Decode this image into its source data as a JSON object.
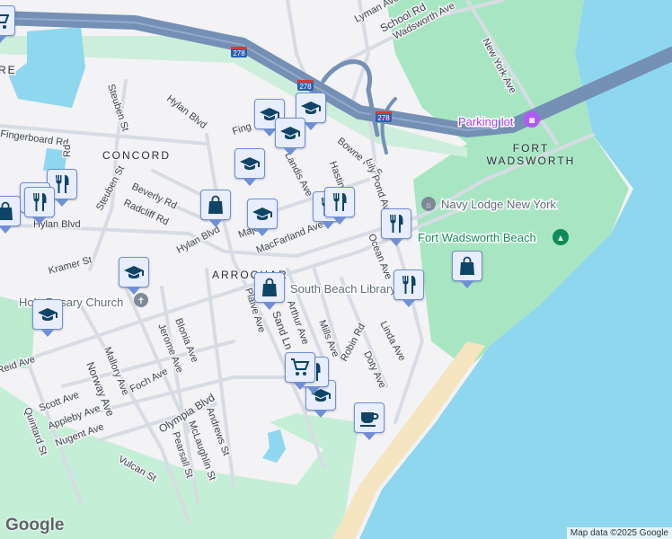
{
  "map": {
    "neighborhoods": [
      "CONCORD",
      "ARROCHAR",
      "FORT WADSWORTH"
    ],
    "neighborhood_partial_left": "RE",
    "streets": {
      "lyman": "Lyman Ave",
      "school": "School Rd",
      "wadsworth": "Wadsworth Ave",
      "new_york": "New York Ave",
      "steuben": "Steuben St",
      "hylan": "Hylan Blvd",
      "fingerboard": "Fingerboard Rd",
      "fing": "Fing",
      "landis": "Landis Ave",
      "hastings": "Hastings St",
      "bowne": "Bowne Rd S",
      "lily_pond": "Lily Pond Ave",
      "beverly": "Beverly Rd",
      "radcliff": "Radcliff Rd",
      "macfarland": "MacFarland Ave",
      "major": "Major",
      "kramer": "Kramer St",
      "ocean": "Ocean Ave",
      "plaive": "Plaive Ave",
      "sand": "Sand Ln",
      "arthur": "Arthur Ave",
      "mills": "Mills Ave",
      "robin": "Robin Rd",
      "doty": "Doty Ave",
      "linda": "Linda Ave",
      "mallory": "Mallory Ave",
      "jerome": "Jerome Ave",
      "blonia": "Blonia Ave",
      "norway": "Norway Ave",
      "foch": "Foch Ave",
      "scott": "Scott Ave",
      "appleby": "Appleby Ave",
      "nugent": "Nugent Ave",
      "quintard": "Quintard St",
      "olympia": "Olympia Blvd",
      "andrews": "Andrews St",
      "mclaughlin": "McLaughlin St",
      "pearsall": "Pearsall St",
      "vulcan": "Vulcan St",
      "reid": "Reid Ave",
      "rd": "Rd"
    },
    "highway_shield": "278",
    "pois": {
      "parking": "Parking lot",
      "navy_lodge": "Navy Lodge New York",
      "beach": "Fort Wadsworth Beach",
      "library": "South Beach Library",
      "church": "Holy Rosary Church"
    },
    "colors": {
      "water": "#8fd7ee",
      "park": "#a8e6c3",
      "highway": "#7590b5",
      "marker_fill": "#e8eeff",
      "marker_icon": "#0e4465",
      "parking": "#a142f4",
      "beach_poi": "#0f8a58"
    }
  },
  "markers": [
    {
      "type": "cart"
    },
    {
      "type": "graduation-cap"
    },
    {
      "type": "graduation-cap"
    },
    {
      "type": "graduation-cap"
    },
    {
      "type": "graduation-cap"
    },
    {
      "type": "graduation-cap"
    },
    {
      "type": "graduation-cap"
    },
    {
      "type": "graduation-cap"
    },
    {
      "type": "graduation-cap"
    },
    {
      "type": "restaurant"
    },
    {
      "type": "restaurant"
    },
    {
      "type": "restaurant"
    },
    {
      "type": "restaurant"
    },
    {
      "type": "restaurant"
    },
    {
      "type": "restaurant"
    },
    {
      "type": "restaurant"
    },
    {
      "type": "restaurant"
    },
    {
      "type": "shopping-bag"
    },
    {
      "type": "shopping-bag"
    },
    {
      "type": "shopping-bag"
    },
    {
      "type": "shopping-bag"
    },
    {
      "type": "cart"
    },
    {
      "type": "coffee"
    }
  ],
  "footer": {
    "logo": "Google",
    "attribution": "Map data ©2025 Google"
  }
}
